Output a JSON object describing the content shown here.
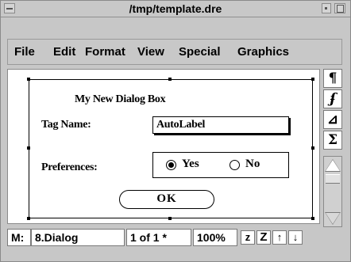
{
  "window": {
    "title": "/tmp/template.dre"
  },
  "menu": {
    "items": [
      "File",
      "Edit",
      "Format",
      "View",
      "Special",
      "Graphics"
    ]
  },
  "dialog": {
    "title": "My New Dialog Box",
    "tag_label": "Tag Name:",
    "tag_value": "AutoLabel",
    "pref_label": "Preferences:",
    "options": [
      {
        "label": "Yes",
        "selected": true
      },
      {
        "label": "No",
        "selected": false
      }
    ],
    "ok_label": "OK"
  },
  "palette": {
    "items": [
      {
        "glyph": "¶",
        "icon": "pilcrow-icon"
      },
      {
        "glyph": "ʄ",
        "icon": "function-icon"
      },
      {
        "glyph": "⊿",
        "icon": "triangle-icon"
      },
      {
        "glyph": "Σ",
        "icon": "sigma-icon"
      }
    ]
  },
  "status": {
    "mode": "M:",
    "dialog": "8.Dialog",
    "page": "1 of 1 *",
    "zoom": "100%",
    "z_small": "z",
    "z_large": "Z",
    "up_glyph": "↑",
    "down_glyph": "↓"
  }
}
